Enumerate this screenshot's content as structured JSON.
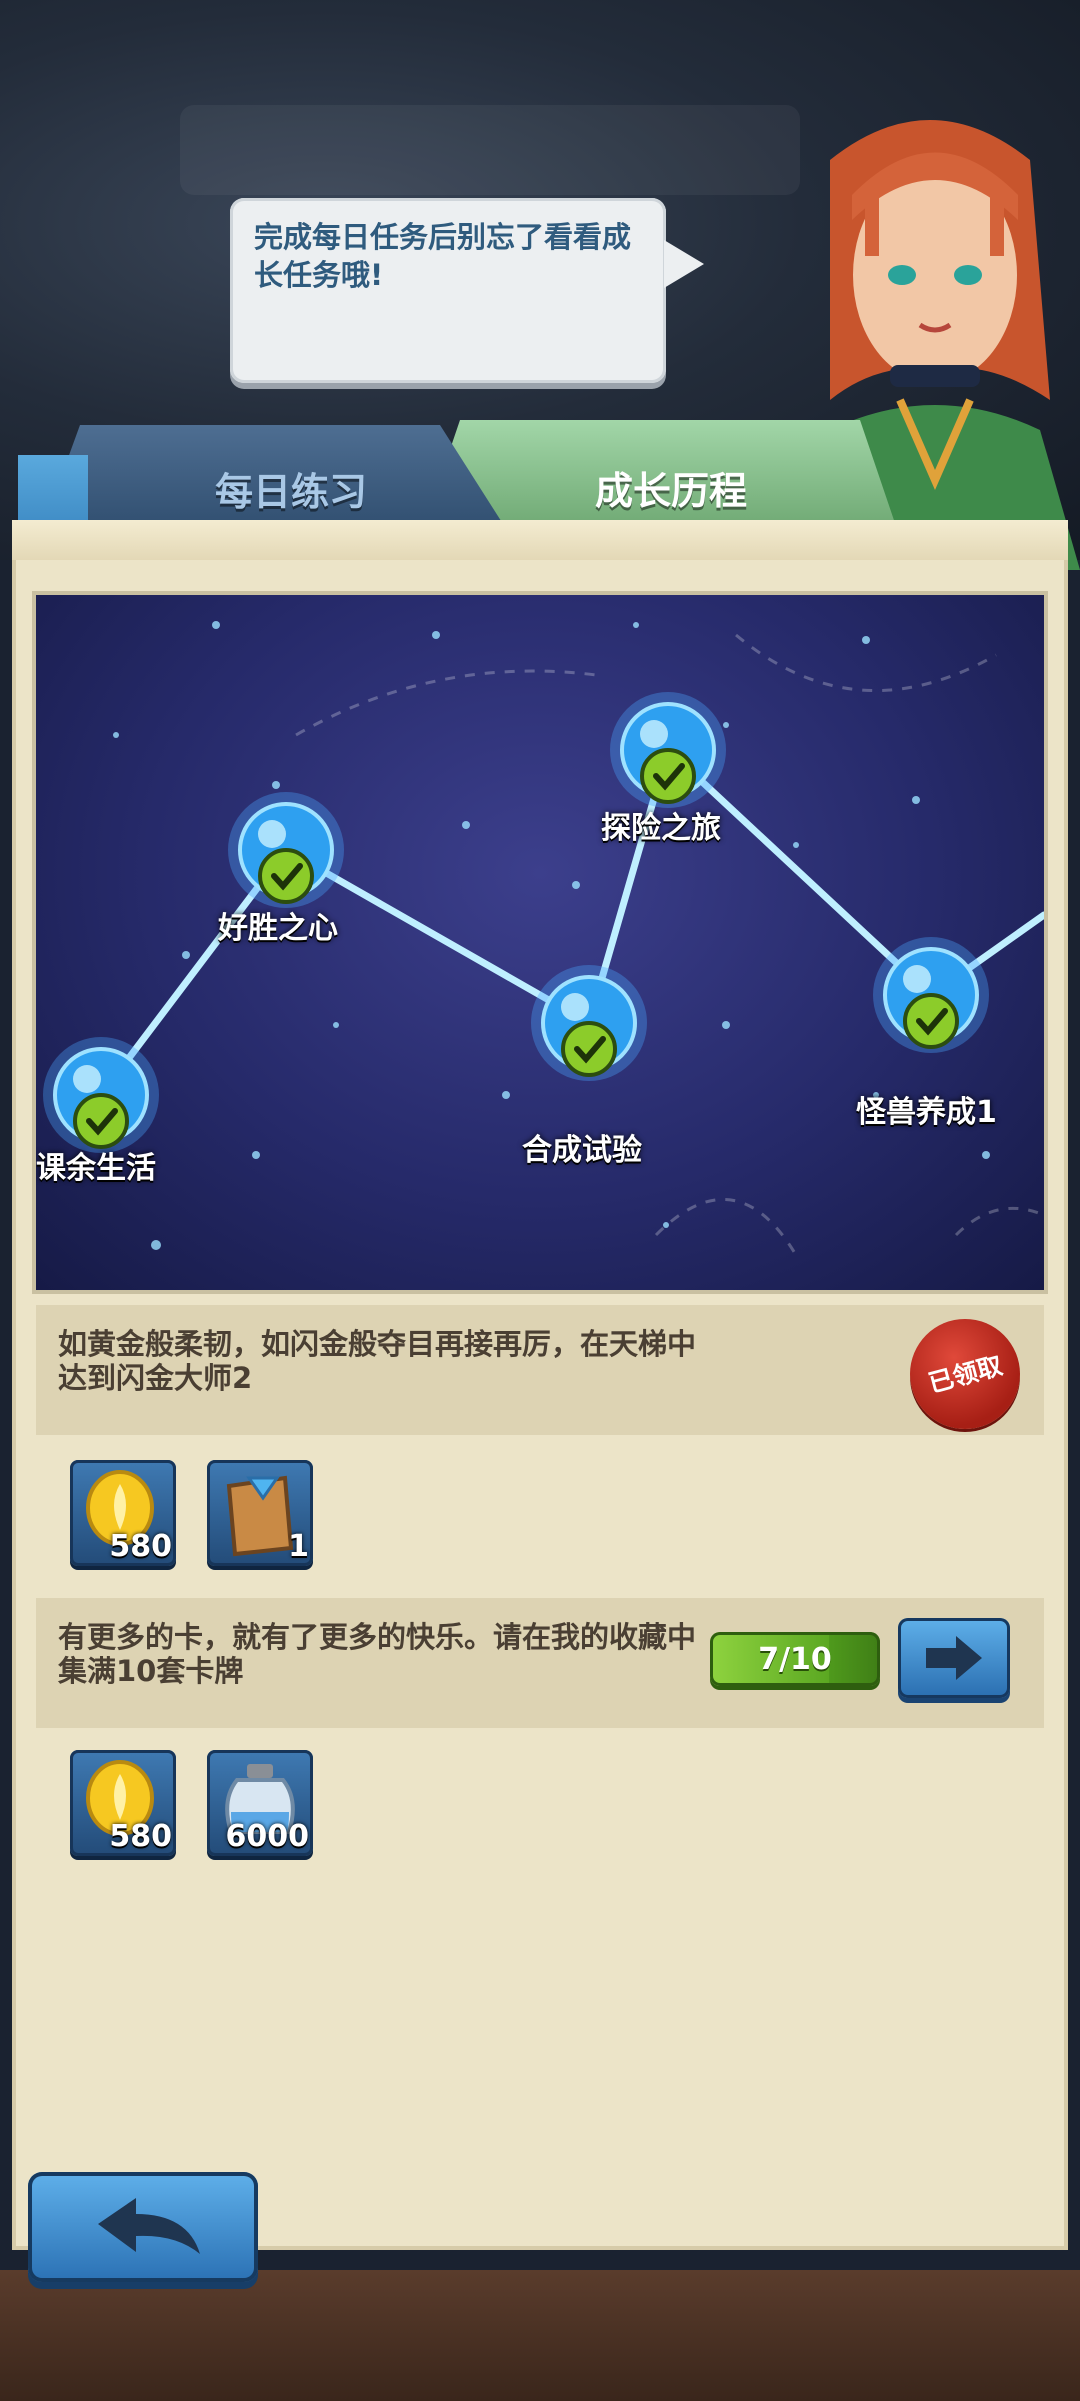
{
  "dialog": {
    "text": "完成每日任务后别忘了看看成长任务哦!"
  },
  "tabs": {
    "daily": "每日练习",
    "growth": "成长历程"
  },
  "constellation": {
    "nodes": [
      {
        "label": "课余生活",
        "completed": true
      },
      {
        "label": "好胜之心",
        "completed": true
      },
      {
        "label": "合成试验",
        "completed": true
      },
      {
        "label": "探险之旅",
        "completed": true
      },
      {
        "label": "怪兽养成1",
        "completed": true
      }
    ]
  },
  "tasks": [
    {
      "description": "如黄金般柔韧，如闪金般夺目再接再厉，在天梯中达到闪金大师2",
      "status_label": "已领取",
      "rewards": [
        {
          "icon": "gold-coin-icon",
          "count": "580"
        },
        {
          "icon": "card-pack-icon",
          "count": "1"
        }
      ]
    },
    {
      "description": "有更多的卡，就有了更多的快乐。请在我的收藏中集满10套卡牌",
      "progress": "7/10",
      "progress_fraction": 0.7,
      "rewards": [
        {
          "icon": "gold-coin-icon",
          "count": "580"
        },
        {
          "icon": "potion-jar-icon",
          "count": "6000"
        }
      ]
    }
  ],
  "colors": {
    "accent_blue": "#2f5b7e",
    "progress_green": "#6fbf2e",
    "seal_red": "#b52418",
    "parchment": "#ece4c8"
  }
}
